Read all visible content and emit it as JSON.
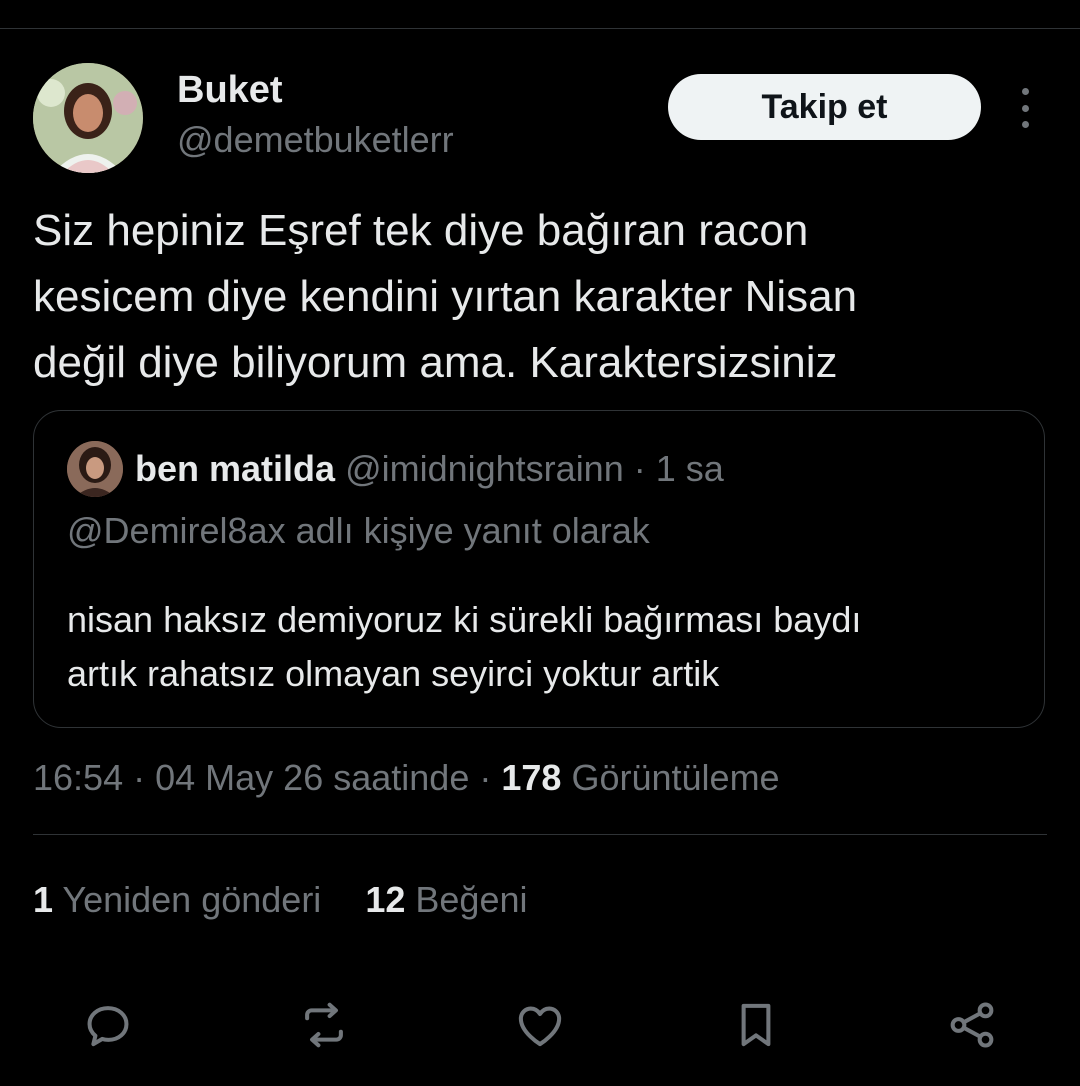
{
  "author": {
    "display_name": "Buket",
    "handle": "@demetbuketlerr"
  },
  "follow_button_label": "Takip et",
  "more_icon": "more-vertical-icon",
  "tweet_text": "Siz hepiniz Eşref tek diye bağıran racon\nkesicem diye kendini yırtan karakter Nisan\ndeğil diye biliyorum ama. Karaktersizsiniz",
  "quoted_tweet": {
    "display_name": "ben matilda",
    "handle": "@imidnightsrainn",
    "separator": "·",
    "time": "1 sa",
    "reply_context": "@Demirel8ax adlı kişiye yanıt olarak",
    "text": "nisan haksız demiyoruz ki sürekli bağırması baydı\nartık rahatsız olmayan seyirci yoktur artik"
  },
  "meta": {
    "time": "16:54",
    "separator": "·",
    "date": "04 May 26 saatinde",
    "views_count": "178",
    "views_label": "Görüntüleme"
  },
  "stats": {
    "reposts_count": "1",
    "reposts_label": "Yeniden gönderi",
    "likes_count": "12",
    "likes_label": "Beğeni"
  },
  "actions": [
    {
      "icon": "reply-icon"
    },
    {
      "icon": "repost-icon"
    },
    {
      "icon": "like-icon"
    },
    {
      "icon": "bookmark-icon"
    },
    {
      "icon": "share-icon"
    }
  ],
  "colors": {
    "background": "#000000",
    "primary_text": "#e7e9ea",
    "secondary_text": "#71767b",
    "border": "#2f3336",
    "button_bg": "#eff3f4",
    "button_text": "#0f1419"
  }
}
